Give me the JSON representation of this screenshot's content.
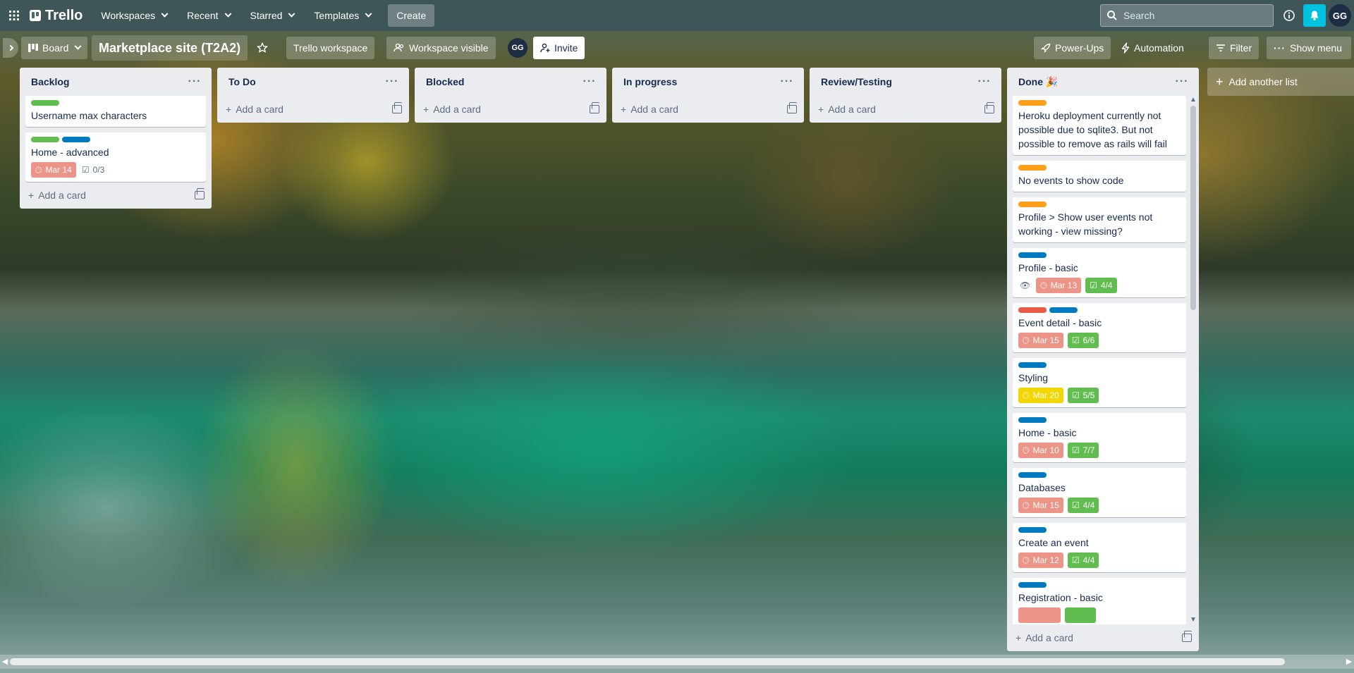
{
  "nav": {
    "app_name": "Trello",
    "workspaces": "Workspaces",
    "recent": "Recent",
    "starred": "Starred",
    "templates": "Templates",
    "create": "Create",
    "search_placeholder": "Search",
    "user_initials": "GG"
  },
  "board": {
    "view": "Board",
    "title": "Marketplace site (T2A2)",
    "workspace": "Trello workspace",
    "visibility": "Workspace visible",
    "member_initials": "GG",
    "invite": "Invite",
    "power_ups": "Power-Ups",
    "automation": "Automation",
    "filter": "Filter",
    "show_menu": "Show menu",
    "add_another_list": "Add another list"
  },
  "colors": {
    "label_green": "#61bd4f",
    "label_blue": "#0079bf",
    "label_orange": "#ff9f1a",
    "label_red": "#eb5a46",
    "due_red": "#ec9488",
    "due_yellow": "#f2d600",
    "check_green": "#61bd4f"
  },
  "add_card": "Add a card",
  "lists": [
    {
      "title": "Backlog",
      "cards": [
        {
          "title": "Username max characters",
          "labels": [
            "green"
          ]
        },
        {
          "title": "Home - advanced",
          "labels": [
            "green",
            "blue"
          ],
          "due": "Mar 14",
          "checklist": "0/3"
        }
      ]
    },
    {
      "title": "To Do",
      "cards": []
    },
    {
      "title": "Blocked",
      "cards": []
    },
    {
      "title": "In progress",
      "cards": []
    },
    {
      "title": "Review/Testing",
      "cards": []
    },
    {
      "title": "Done 🎉",
      "cards": [
        {
          "title": "Heroku deployment currently not possible due to sqlite3. But not possible to remove as rails will fail",
          "labels": [
            "orange"
          ]
        },
        {
          "title": "No events to show code",
          "labels": [
            "orange"
          ]
        },
        {
          "title": "Profile > Show user events not working - view missing?",
          "labels": [
            "orange"
          ]
        },
        {
          "title": "Profile - basic",
          "labels": [
            "blue"
          ],
          "watching": true,
          "due": "Mar 13",
          "checklist": "4/4"
        },
        {
          "title": "Event detail - basic",
          "labels": [
            "red",
            "blue"
          ],
          "due": "Mar 15",
          "checklist": "6/6"
        },
        {
          "title": "Styling",
          "labels": [
            "blue"
          ],
          "due": "Mar 20",
          "due_color": "yellow",
          "checklist": "5/5"
        },
        {
          "title": "Home - basic",
          "labels": [
            "blue"
          ],
          "due": "Mar 10",
          "checklist": "7/7"
        },
        {
          "title": "Databases",
          "labels": [
            "blue"
          ],
          "due": "Mar 15",
          "checklist": "4/4"
        },
        {
          "title": "Create an event",
          "labels": [
            "blue"
          ],
          "due": "Mar 12",
          "checklist": "4/4"
        },
        {
          "title": "Registration - basic",
          "labels": [
            "blue"
          ]
        }
      ]
    }
  ]
}
